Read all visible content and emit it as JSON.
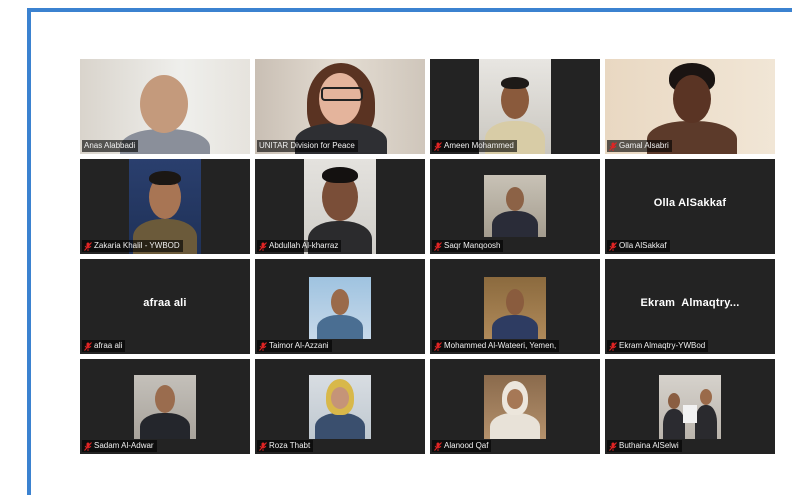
{
  "meeting": {
    "participants": [
      {
        "name": "Anas Alabbadi",
        "muted": false
      },
      {
        "name": "UNITAR Division for Peace",
        "muted": false
      },
      {
        "name": "Ameen Mohammed",
        "muted": true
      },
      {
        "name": "Gamal Alsabri",
        "muted": true
      },
      {
        "name": "Zakaria Khalil - YWBOD",
        "muted": true
      },
      {
        "name": "Abdullah Al-kharraz",
        "muted": true
      },
      {
        "name": "Saqr Manqoosh",
        "muted": true
      },
      {
        "name": "Olla AlSakkaf",
        "muted": true,
        "display_name": "Olla AlSakkaf"
      },
      {
        "name": "afraa ali",
        "muted": true,
        "display_name": "afraa ali"
      },
      {
        "name": "Taimor Al-Azzani",
        "muted": true
      },
      {
        "name": "Mohammed Al-Wateeri, Yemen,",
        "muted": true
      },
      {
        "name": "Ekram Almaqtry-YWBod",
        "muted": true,
        "display_name": "Ekram  Almaqtry..."
      },
      {
        "name": "Sadam Al-Adwar",
        "muted": true
      },
      {
        "name": "Roza Thabt",
        "muted": true
      },
      {
        "name": "Alanood Qaf",
        "muted": true
      },
      {
        "name": "Buthaina AlSelwi",
        "muted": true
      }
    ]
  },
  "colors": {
    "frame_border": "#3b82d0",
    "tile_background": "#232323",
    "muted_icon": "#e02424"
  },
  "icons": {
    "muted": "microphone-muted-icon"
  }
}
